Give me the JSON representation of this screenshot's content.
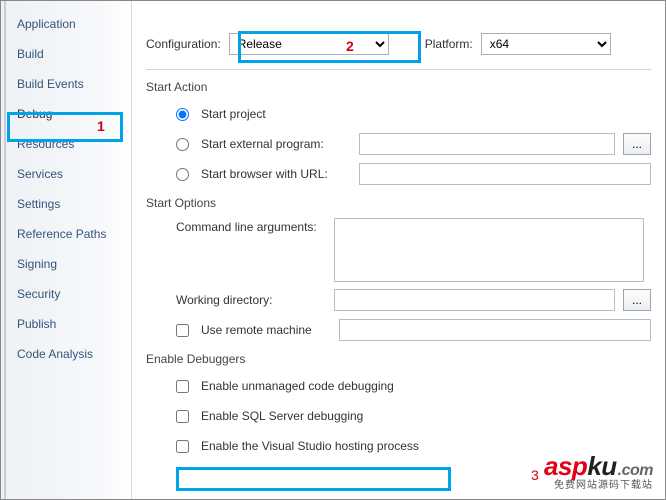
{
  "sidebar": {
    "items": [
      "Application",
      "Build",
      "Build Events",
      "Debug",
      "Resources",
      "Services",
      "Settings",
      "Reference Paths",
      "Signing",
      "Security",
      "Publish",
      "Code Analysis"
    ],
    "selected_index": 3
  },
  "configRow": {
    "config_label": "Configuration:",
    "config_value": "Release",
    "platform_label": "Platform:",
    "platform_value": "x64"
  },
  "startAction": {
    "title": "Start Action",
    "start_project": "Start project",
    "start_external": "Start external program:",
    "start_browser": "Start browser with URL:",
    "browse": "...",
    "selected": "project",
    "external_value": "",
    "browser_value": ""
  },
  "startOptions": {
    "title": "Start Options",
    "args_label": "Command line arguments:",
    "args_value": "",
    "wd_label": "Working directory:",
    "wd_value": "",
    "browse": "...",
    "remote_label": "Use remote machine",
    "remote_checked": false,
    "remote_value": ""
  },
  "enableDebuggers": {
    "title": "Enable Debuggers",
    "unmanaged": "Enable unmanaged code debugging",
    "sql": "Enable SQL Server debugging",
    "hosting": "Enable the Visual Studio hosting process",
    "unmanaged_checked": false,
    "sql_checked": false,
    "hosting_checked": false
  },
  "annotations": {
    "a1": "1",
    "a2": "2",
    "a3": "3"
  },
  "watermark": {
    "brand_a": "asp",
    "brand_b": "ku",
    "brand_c": ".com",
    "tagline": "免费网站源码下载站"
  }
}
